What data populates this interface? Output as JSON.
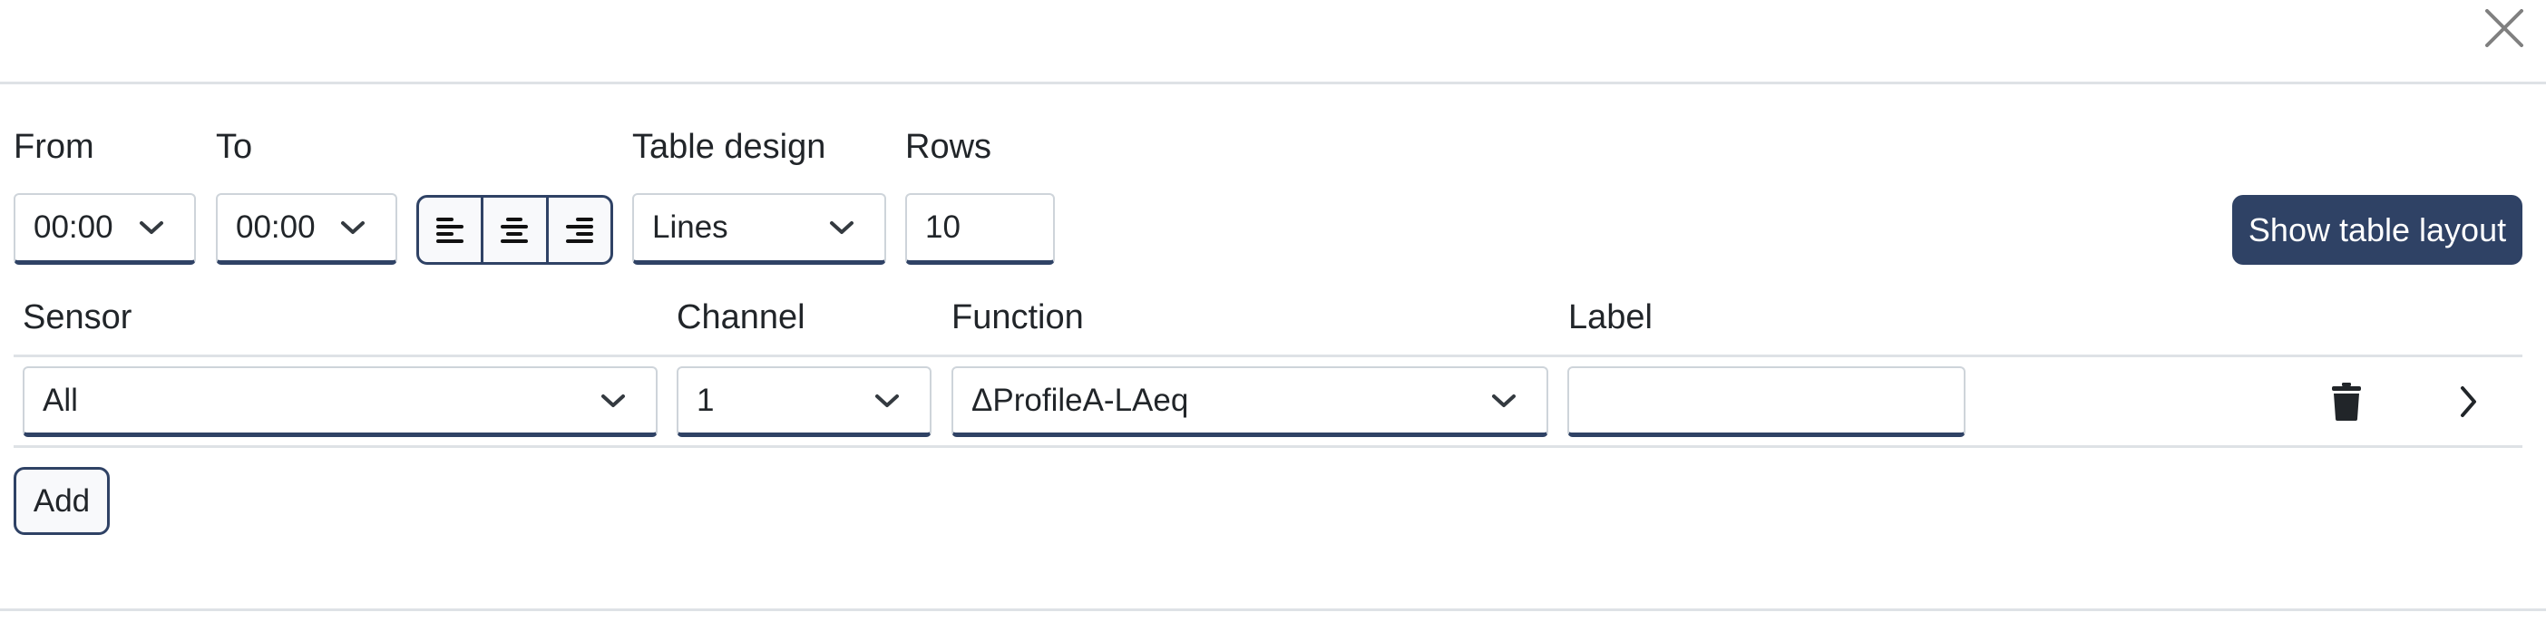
{
  "dialog": {
    "close_icon": "close-icon"
  },
  "toolbar": {
    "from": {
      "label": "From",
      "value": "00:00"
    },
    "to": {
      "label": "To",
      "value": "00:00"
    },
    "alignment": {
      "options": [
        {
          "name": "align-left",
          "icon": "align-left-icon"
        },
        {
          "name": "align-center",
          "icon": "align-center-icon"
        },
        {
          "name": "align-right",
          "icon": "align-right-icon"
        }
      ]
    },
    "table_design": {
      "label": "Table design",
      "value": "Lines"
    },
    "rows": {
      "label": "Rows",
      "value": "10"
    },
    "show_layout_label": "Show table layout"
  },
  "columns": {
    "headers": [
      "Sensor",
      "Channel",
      "Function",
      "Label"
    ]
  },
  "rows": [
    {
      "sensor": "All",
      "channel": "1",
      "function": "ΔProfileA-LAeq",
      "label": "",
      "actions": [
        "trash-icon",
        "chevron-right-icon"
      ]
    }
  ],
  "add_label": "Add",
  "colors": {
    "accent": "#2f4265",
    "border": "#ced4da",
    "divider": "#dee2e6",
    "text": "#212529",
    "close": "#808080"
  }
}
